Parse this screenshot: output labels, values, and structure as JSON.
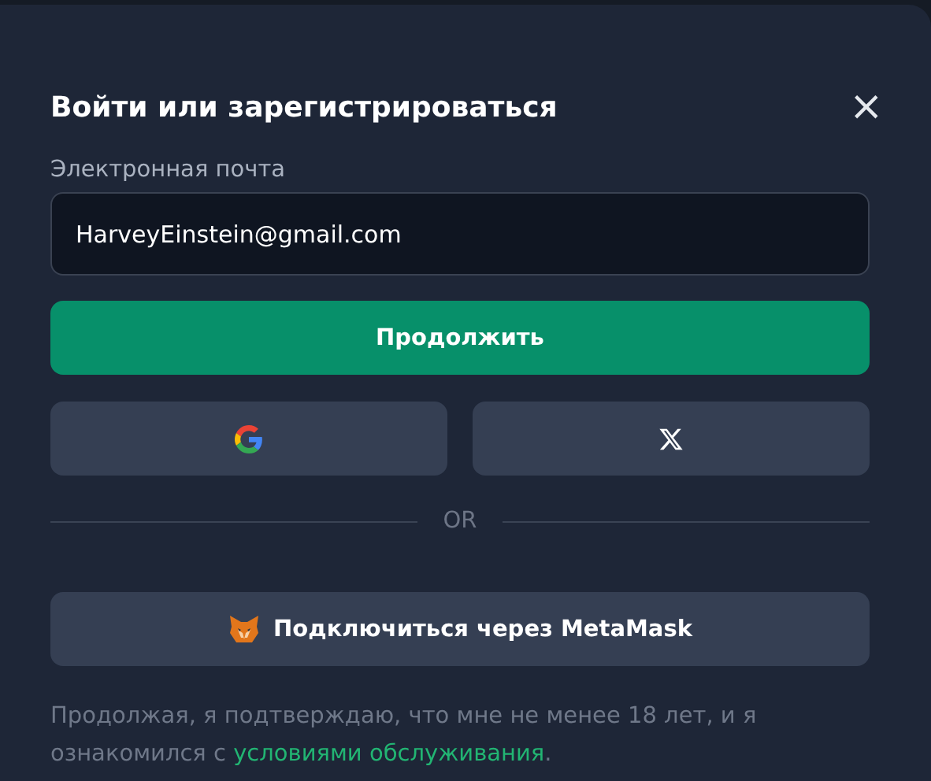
{
  "dialog": {
    "title": "Войти или зарегистрироваться",
    "close": "×"
  },
  "email": {
    "label": "Электронная почта",
    "value": "HarveyEinstein@gmail.com"
  },
  "continue_button": "Продолжить",
  "social_buttons": [
    {
      "kind": "google"
    },
    {
      "kind": "x"
    }
  ],
  "divider": "OR",
  "metamask_button": "Подключиться через MetaMask",
  "legal": {
    "text": "Продолжая, я подтверждаю, что мне не менее 18 лет, и я ознакомился с ",
    "link": "условиями обслуживания",
    "end": "."
  }
}
